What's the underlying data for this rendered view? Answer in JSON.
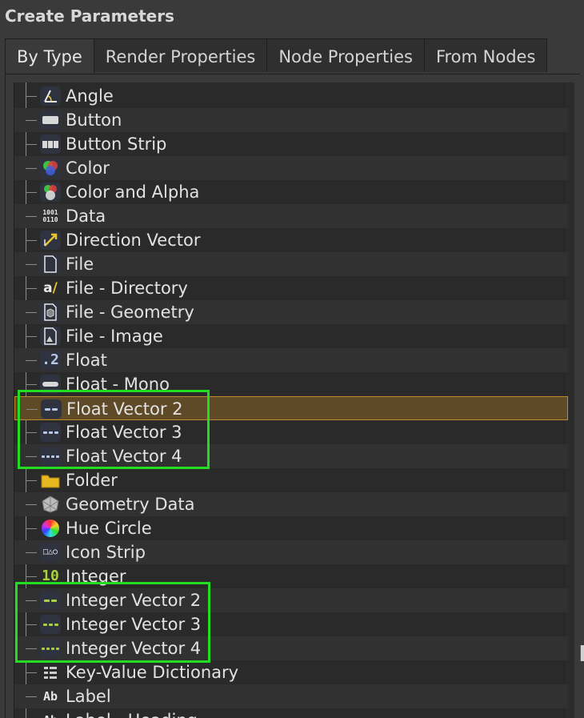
{
  "title": "Create Parameters",
  "tabs": [
    {
      "label": "By Type",
      "active": true
    },
    {
      "label": "Render Properties",
      "active": false
    },
    {
      "label": "Node Properties",
      "active": false
    },
    {
      "label": "From Nodes",
      "active": false
    }
  ],
  "items": [
    {
      "label": "Angle",
      "icon": "angle-icon"
    },
    {
      "label": "Button",
      "icon": "button-icon"
    },
    {
      "label": "Button Strip",
      "icon": "button-strip-icon"
    },
    {
      "label": "Color",
      "icon": "color-icon"
    },
    {
      "label": "Color and Alpha",
      "icon": "color-alpha-icon"
    },
    {
      "label": "Data",
      "icon": "data-icon",
      "glyph": "1001\n0110"
    },
    {
      "label": "Direction Vector",
      "icon": "direction-vector-icon"
    },
    {
      "label": "File",
      "icon": "file-icon"
    },
    {
      "label": "File - Directory",
      "icon": "file-directory-icon",
      "glyph": "a/"
    },
    {
      "label": "File - Geometry",
      "icon": "file-geometry-icon"
    },
    {
      "label": "File - Image",
      "icon": "file-image-icon"
    },
    {
      "label": "Float",
      "icon": "float-icon",
      "glyph": ".2"
    },
    {
      "label": "Float - Mono",
      "icon": "float-mono-icon"
    },
    {
      "label": "Float Vector 2",
      "icon": "float-vector-2-icon",
      "selected": true
    },
    {
      "label": "Float Vector 3",
      "icon": "float-vector-3-icon"
    },
    {
      "label": "Float Vector 4",
      "icon": "float-vector-4-icon"
    },
    {
      "label": "Folder",
      "icon": "folder-icon"
    },
    {
      "label": "Geometry Data",
      "icon": "geometry-data-icon"
    },
    {
      "label": "Hue Circle",
      "icon": "hue-circle-icon"
    },
    {
      "label": "Icon Strip",
      "icon": "icon-strip-icon",
      "glyph": "□△○"
    },
    {
      "label": "Integer",
      "icon": "integer-icon",
      "glyph": "10"
    },
    {
      "label": "Integer Vector 2",
      "icon": "integer-vector-2-icon"
    },
    {
      "label": "Integer Vector 3",
      "icon": "integer-vector-3-icon"
    },
    {
      "label": "Integer Vector 4",
      "icon": "integer-vector-4-icon"
    },
    {
      "label": "Key-Value Dictionary",
      "icon": "key-value-icon"
    },
    {
      "label": "Label",
      "icon": "label-icon",
      "glyph": "Ab"
    },
    {
      "label": "Label - Heading",
      "icon": "label-heading-icon",
      "glyph": "Ab"
    }
  ],
  "colors": {
    "selection_bg": "#5f4a28",
    "selection_border": "#c08a30",
    "highlight": "#22dd22",
    "float_accent": "#b8c8e8",
    "integer_accent": "#a8d040"
  }
}
